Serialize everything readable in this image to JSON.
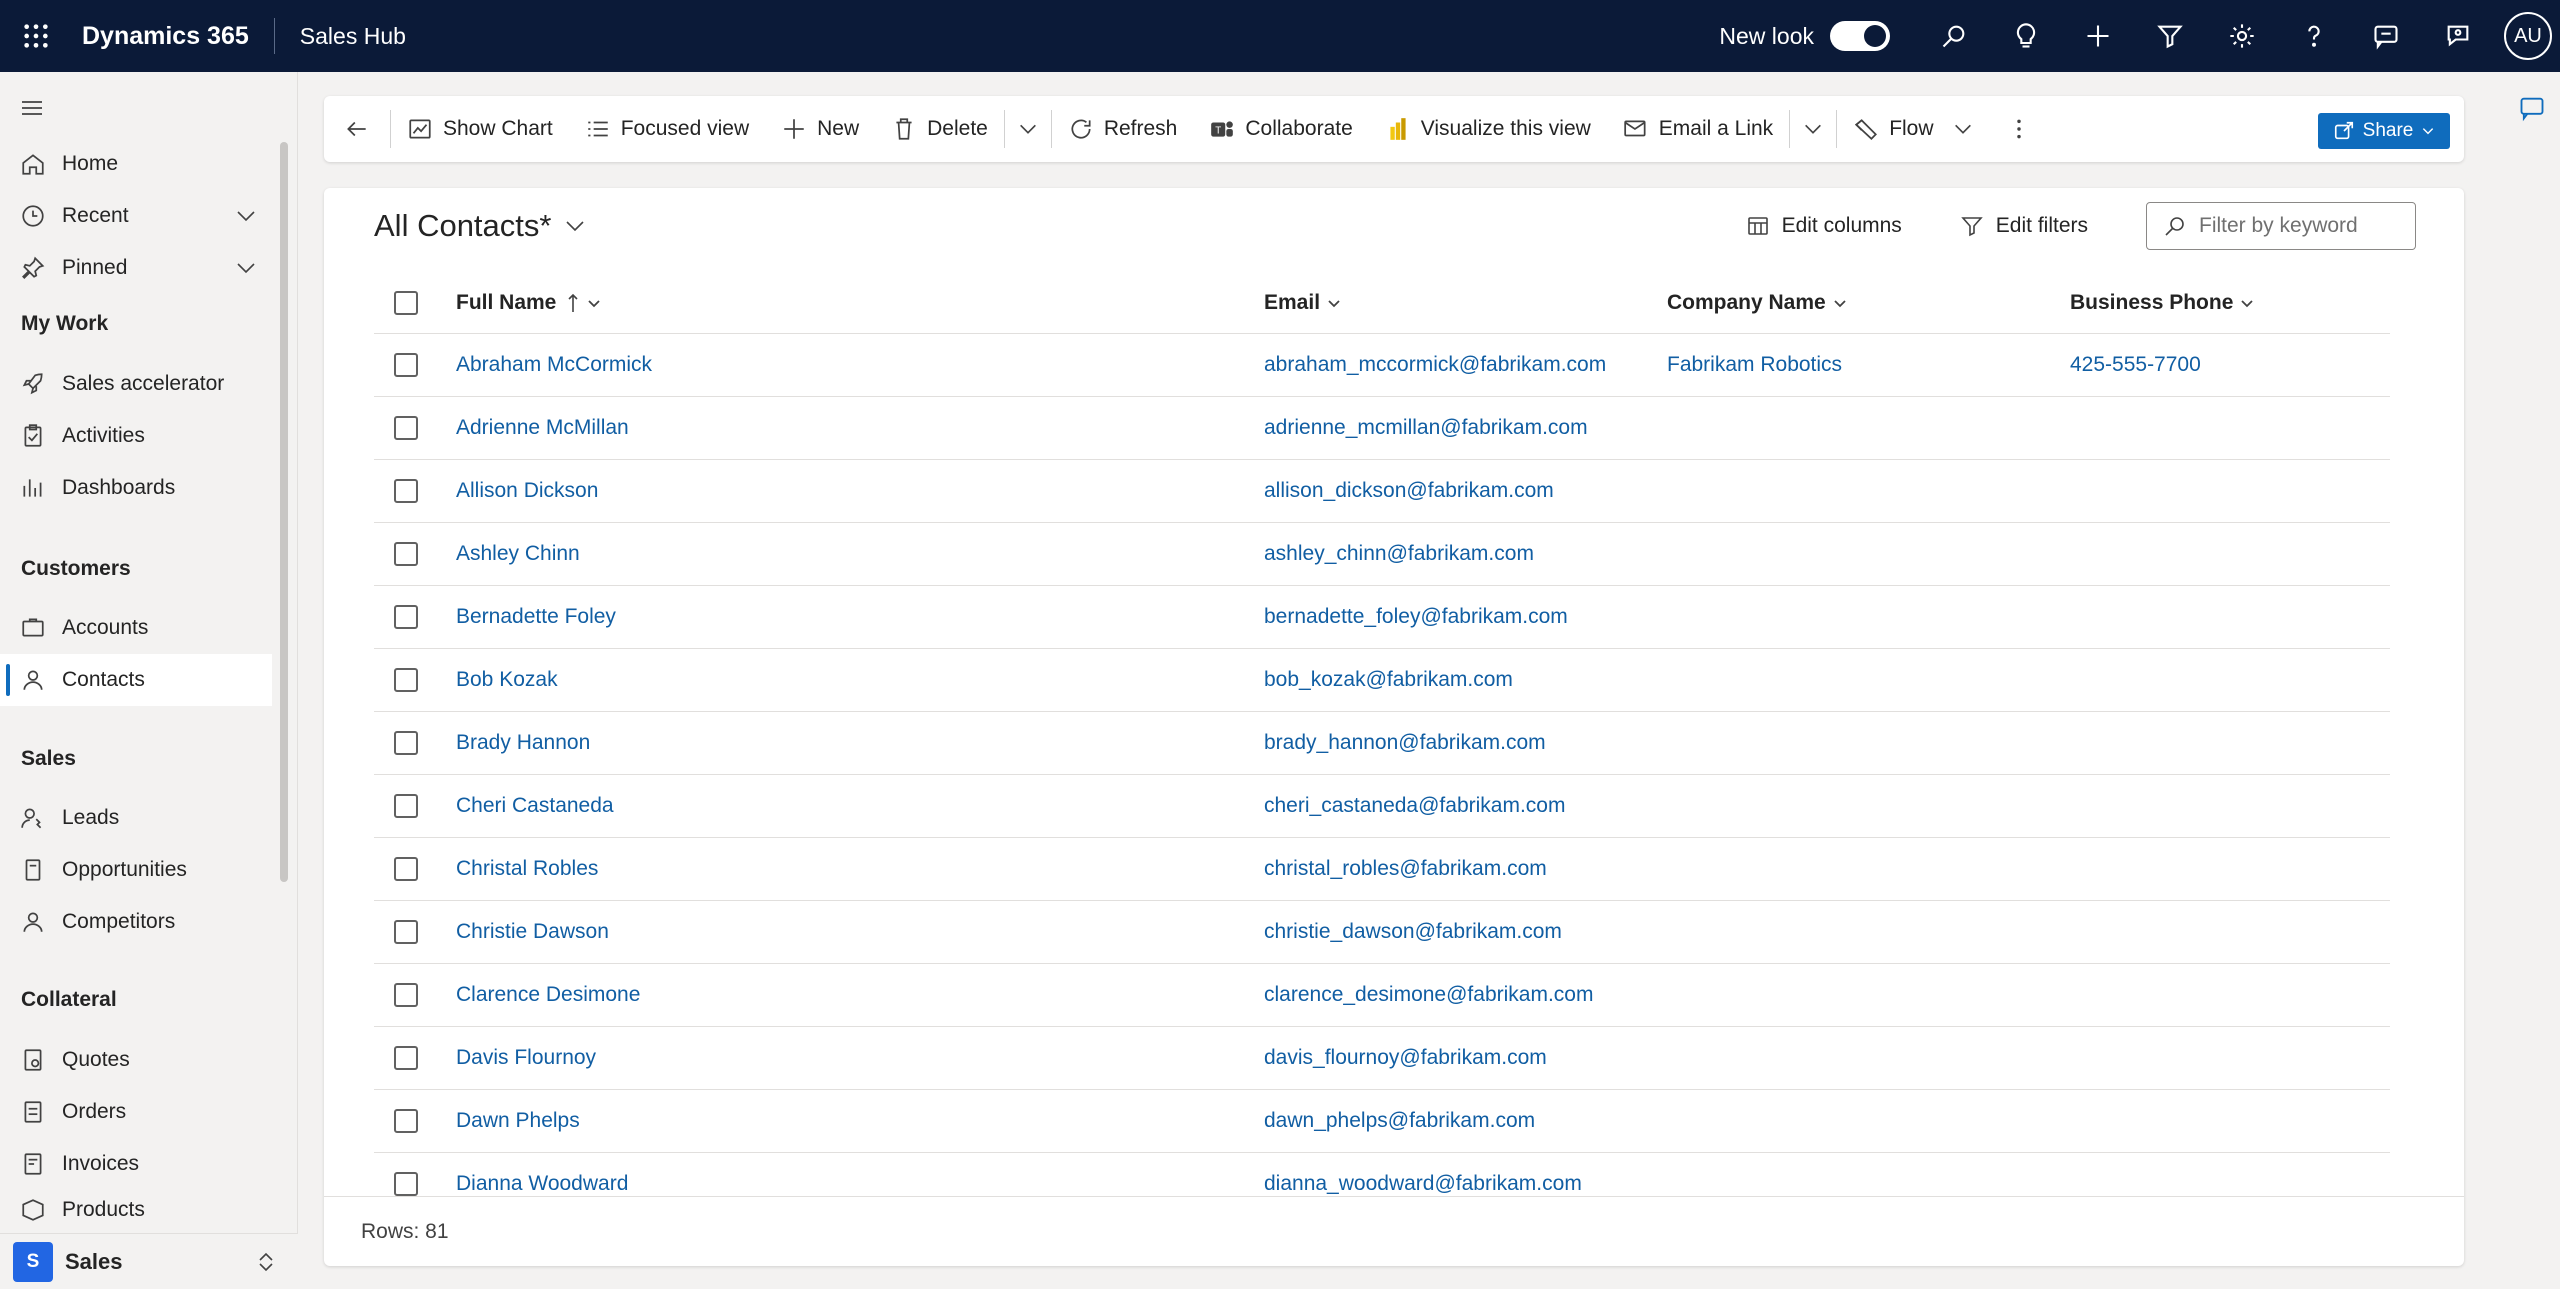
{
  "topbar": {
    "app_name": "Dynamics 365",
    "area_title": "Sales Hub",
    "new_look_label": "New look",
    "avatar_initials": "AU"
  },
  "nav": {
    "items_top": [
      {
        "label": "Home",
        "icon": "home-icon"
      },
      {
        "label": "Recent",
        "icon": "clock-icon"
      },
      {
        "label": "Pinned",
        "icon": "pin-icon"
      }
    ],
    "groups": [
      {
        "title": "My Work",
        "items": [
          "Sales accelerator",
          "Activities",
          "Dashboards"
        ]
      },
      {
        "title": "Customers",
        "items": [
          "Accounts",
          "Contacts"
        ]
      },
      {
        "title": "Sales",
        "items": [
          "Leads",
          "Opportunities",
          "Competitors"
        ]
      },
      {
        "title": "Collateral",
        "items": [
          "Quotes",
          "Orders",
          "Invoices",
          "Products"
        ]
      }
    ],
    "active_item": "Contacts",
    "area_badge": "S",
    "area_name": "Sales"
  },
  "commandbar": {
    "show_chart": "Show Chart",
    "focused_view": "Focused view",
    "new": "New",
    "delete": "Delete",
    "refresh": "Refresh",
    "collaborate": "Collaborate",
    "visualize": "Visualize this view",
    "email_link": "Email a Link",
    "flow": "Flow",
    "share": "Share"
  },
  "view": {
    "title": "All Contacts*",
    "edit_columns": "Edit columns",
    "edit_filters": "Edit filters",
    "filter_placeholder": "Filter by keyword",
    "rows_label": "Rows: 81"
  },
  "grid": {
    "columns": [
      "Full Name",
      "Email",
      "Company Name",
      "Business Phone"
    ],
    "rows": [
      {
        "name": "Abraham McCormick",
        "email": "abraham_mccormick@fabrikam.com",
        "company": "Fabrikam Robotics",
        "phone": "425-555-7700"
      },
      {
        "name": "Adrienne McMillan",
        "email": "adrienne_mcmillan@fabrikam.com",
        "company": "",
        "phone": ""
      },
      {
        "name": "Allison Dickson",
        "email": "allison_dickson@fabrikam.com",
        "company": "",
        "phone": ""
      },
      {
        "name": "Ashley Chinn",
        "email": "ashley_chinn@fabrikam.com",
        "company": "",
        "phone": ""
      },
      {
        "name": "Bernadette Foley",
        "email": "bernadette_foley@fabrikam.com",
        "company": "",
        "phone": ""
      },
      {
        "name": "Bob Kozak",
        "email": "bob_kozak@fabrikam.com",
        "company": "",
        "phone": ""
      },
      {
        "name": "Brady Hannon",
        "email": "brady_hannon@fabrikam.com",
        "company": "",
        "phone": ""
      },
      {
        "name": "Cheri Castaneda",
        "email": "cheri_castaneda@fabrikam.com",
        "company": "",
        "phone": ""
      },
      {
        "name": "Christal Robles",
        "email": "christal_robles@fabrikam.com",
        "company": "",
        "phone": ""
      },
      {
        "name": "Christie Dawson",
        "email": "christie_dawson@fabrikam.com",
        "company": "",
        "phone": ""
      },
      {
        "name": "Clarence Desimone",
        "email": "clarence_desimone@fabrikam.com",
        "company": "",
        "phone": ""
      },
      {
        "name": "Davis Flournoy",
        "email": "davis_flournoy@fabrikam.com",
        "company": "",
        "phone": ""
      },
      {
        "name": "Dawn Phelps",
        "email": "dawn_phelps@fabrikam.com",
        "company": "",
        "phone": ""
      },
      {
        "name": "Dianna Woodward",
        "email": "dianna_woodward@fabrikam.com",
        "company": "",
        "phone": ""
      }
    ]
  },
  "colors": {
    "topbar_bg": "#0b1a38",
    "link": "#115ea3",
    "accent": "#0f6cbd"
  }
}
